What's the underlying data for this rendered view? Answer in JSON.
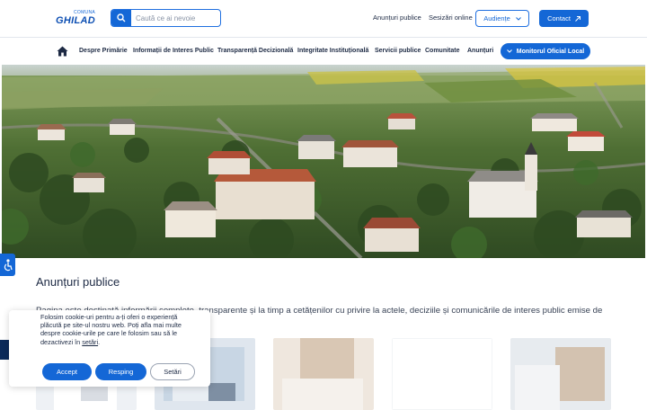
{
  "header": {
    "logo_small": "COMUNA",
    "logo_big": "GHILAD",
    "search_placeholder": "Caută ce ai nevoie",
    "link_announcements": "Anunțuri publice",
    "link_reports": "Sesizări online",
    "audience_label": "Audiențe",
    "contact_label": "Contact"
  },
  "nav": {
    "items": [
      "Despre Primărie",
      "Informații de Interes Public",
      "Transparență Decizională",
      "Integritate Instituțională",
      "Servicii publice",
      "Comunitate",
      "Anunțuri"
    ],
    "monitor_label": "Monitorul Oficial Local"
  },
  "section": {
    "title": "Anunțuri publice",
    "intro": "Pagina este destinată informării complete, transparente și la timp a cetățenilor cu privire la actele, deciziile și comunicările de interes public emise de"
  },
  "cookie": {
    "text": "Folosim cookie-uri pentru a-ți oferi o experiență plăcută pe site-ul nostru web. Poți afla mai multe despre cookie-urile pe care le folosim sau să le dezactivezi în",
    "link": "setări",
    "suffix": ".",
    "accept": "Accept",
    "reject": "Resping",
    "settings": "Setări"
  },
  "colors": {
    "primary": "#1467d6",
    "dark_navy": "#0b2a5a",
    "text": "#1d2a44"
  }
}
